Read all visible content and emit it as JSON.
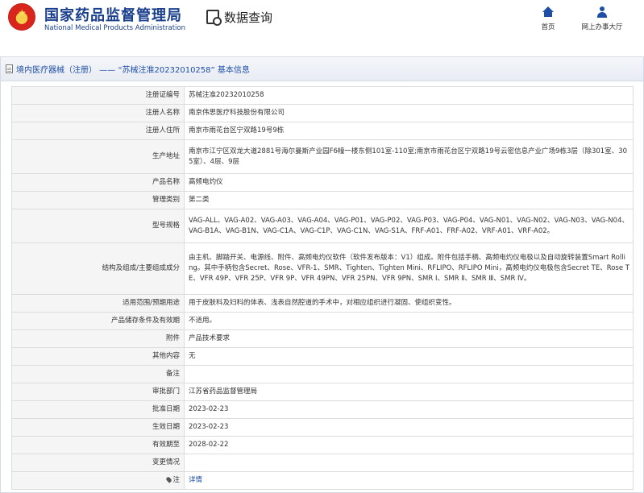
{
  "header": {
    "brand_cn": "国家药品监督管理局",
    "brand_en": "National Medical Products Administration",
    "query_title": "数据查询",
    "nav": [
      {
        "label": "首页",
        "icon": "home-icon"
      },
      {
        "label": "网上办事大厅",
        "icon": "user-icon"
      }
    ]
  },
  "breadcrumb": "境内医疗器械（注册） —— “苏械注准20232010258” 基本信息",
  "colors": {
    "brand": "#1a3f8c",
    "accent": "#1e4ea5",
    "emblem_red": "#d8261c"
  },
  "rows": [
    {
      "label": "注册证编号",
      "value": "苏械注准20232010258"
    },
    {
      "label": "注册人名称",
      "value": "南京伟思医疗科技股份有限公司"
    },
    {
      "label": "注册人住所",
      "value": "南京市雨花台区宁双路19号9栋"
    },
    {
      "label": "生产地址",
      "value": "南京市江宁区双龙大道2881号海尔曼斯产业园F6幢一楼东侧101室-110室;南京市雨花台区宁双路19号云密信息产业广场9栋3层（除301室、305室）、4层、9层"
    },
    {
      "label": "产品名称",
      "value": "高频电灼仪"
    },
    {
      "label": "管理类别",
      "value": "第二类"
    },
    {
      "label": "型号规格",
      "value": "VAG-ALL、VAG-A02、VAG-A03、VAG-A04、VAG-P01、VAG-P02、VAG-P03、VAG-P04、VAG-N01、VAG-N02、VAG-N03、VAG-N04、VAG-B1A、VAG-B1N、VAG-C1A、VAG-C1P、VAG-C1N、VAG-S1A、FRF-A01、FRF-A02、VRF-A01、VRF-A02。"
    },
    {
      "label": "结构及组成/主要组成成分",
      "value": "由主机、脚踏开关、电源线、附件、高频电灼仪软件（软件发布版本：V1）组成。附件包括手柄、高频电灼仪电极以及自动旋转装置Smart Rolling。其中手柄包含Secret、Rose、VFR-1、SMR、Tighten、Tighten Mini、RFLIPO、RFLIPO Mini，高频电灼仪电极包含Secret TE、Rose TE、VFR 49P、VFR 25P、VFR 9P、VFR 49PN、VFR 25PN、VFR 9PN、SMR Ⅰ、SMR Ⅱ、SMR Ⅲ、SMR Ⅳ。"
    },
    {
      "label": "适用范围/预期用途",
      "value": "用于皮肤科及妇科的体表、浅表自然腔道的手术中，对相应组织进行凝固、使组织变性。"
    },
    {
      "label": "产品储存条件及有效期",
      "value": "不适用。"
    },
    {
      "label": "附件",
      "value": "产品技术要求"
    },
    {
      "label": "其他内容",
      "value": "无"
    },
    {
      "label": "备注",
      "value": ""
    },
    {
      "label": "审批部门",
      "value": "江苏省药品监督管理局"
    },
    {
      "label": "批准日期",
      "value": "2023-02-23"
    },
    {
      "label": "生效日期",
      "value": "2023-02-23"
    },
    {
      "label": "有效期至",
      "value": "2028-02-22"
    },
    {
      "label": "变更情况",
      "value": ""
    },
    {
      "label": "注",
      "value": "详情",
      "pin_icon": "pin-icon",
      "link": true
    }
  ]
}
